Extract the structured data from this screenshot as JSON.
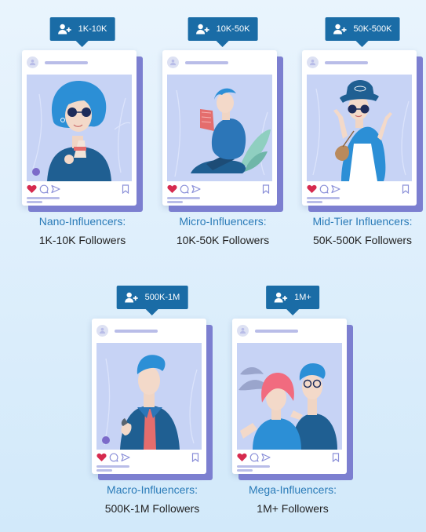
{
  "tiers": [
    {
      "range": "1K-10K",
      "title": "Nano-Influencers:",
      "followers": "1K-10K Followers"
    },
    {
      "range": "10K-50K",
      "title": "Micro-Influencers:",
      "followers": "10K-50K Followers"
    },
    {
      "range": "50K-500K",
      "title": "Mid-Tier Influencers:",
      "followers": "50K-500K Followers"
    },
    {
      "range": "500K-1M",
      "title": "Macro-Influencers:",
      "followers": "500K-1M Followers"
    },
    {
      "range": "1M+",
      "title": "Mega-Influencers:",
      "followers": "1M+ Followers"
    }
  ],
  "colors": {
    "badge": "#1a6ca6",
    "title_text": "#2a7bb8",
    "card_shadow": "#7c7fd0",
    "photo_bg": "#c7d3f5",
    "like_heart": "#d62a4e"
  },
  "icons": {
    "badge": "add-user-icon",
    "like": "heart-icon",
    "comment": "comment-icon",
    "share": "send-icon",
    "save": "bookmark-icon",
    "profile": "user-avatar-icon"
  }
}
